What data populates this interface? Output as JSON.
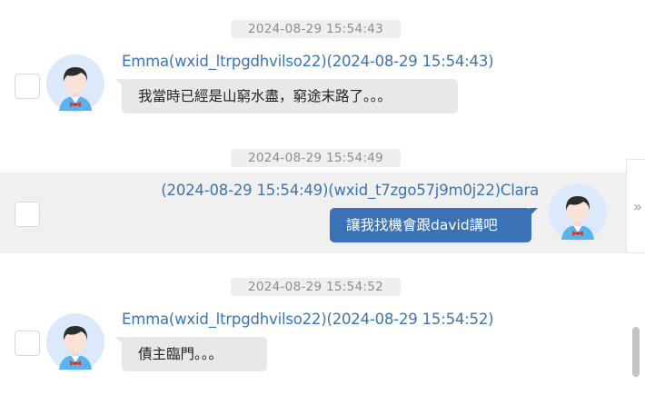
{
  "messages": [
    {
      "timestamp": "2024-08-29 15:54:43",
      "direction": "incoming",
      "sender_line": "Emma(wxid_ltrpgdhvilso22)(2024-08-29 15:54:43)",
      "text": "我當時已經是山窮水盡，窮途末路了。。。",
      "avatar_icon": "user-avatar-icon"
    },
    {
      "timestamp": "2024-08-29 15:54:49",
      "direction": "outgoing",
      "sender_line": "(2024-08-29 15:54:49)(wxid_t7zgo57j9m0j22)Clara",
      "text": "讓我找機會跟david講吧",
      "avatar_icon": "user-avatar-icon"
    },
    {
      "timestamp": "2024-08-29 15:54:52",
      "direction": "incoming",
      "sender_line": "Emma(wxid_ltrpgdhvilso22)(2024-08-29 15:54:52)",
      "text": "債主臨門。。。",
      "avatar_icon": "user-avatar-icon"
    }
  ],
  "side_panel_toggle": {
    "glyph": "»",
    "icon": "double-chevron-right-icon"
  },
  "colors": {
    "name_link": "#3b74b3",
    "outgoing_bubble": "#3b72b6",
    "incoming_bubble": "#e8e8e8",
    "selected_row": "#f0f0f0",
    "timestamp_bg": "#efefef",
    "timestamp_text": "#8d8d8d"
  }
}
